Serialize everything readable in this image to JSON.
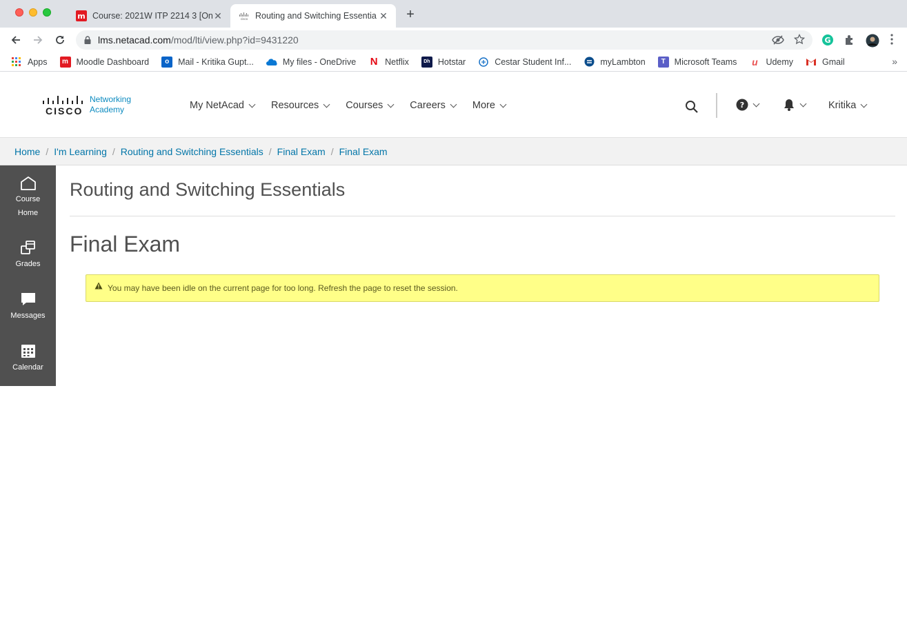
{
  "browser": {
    "tabs": [
      {
        "title": "Course: 2021W ITP 2214 3 [On",
        "favicon": "moodle-icon",
        "active": false
      },
      {
        "title": "Routing and Switching Essentia",
        "favicon": "cisco-icon",
        "active": true
      }
    ],
    "url_host": "lms.netacad.com",
    "url_path": "/mod/lti/view.php?id=9431220",
    "bookmarks": [
      {
        "label": "Apps",
        "icon": "apps-grid-icon"
      },
      {
        "label": "Moodle Dashboard",
        "icon": "moodle-icon",
        "color": "#e21a22"
      },
      {
        "label": "Mail - Kritika Gupt...",
        "icon": "outlook-icon",
        "color": "#0a64c8"
      },
      {
        "label": "My files - OneDrive",
        "icon": "onedrive-icon",
        "color": "#0a78d4"
      },
      {
        "label": "Netflix",
        "icon": "netflix-icon",
        "color": "#e50914"
      },
      {
        "label": "Hotstar",
        "icon": "hotstar-icon",
        "color": "#0f1a4a"
      },
      {
        "label": "Cestar Student Inf...",
        "icon": "cestar-icon",
        "color": "#1a73c8"
      },
      {
        "label": "myLambton",
        "icon": "lambton-icon",
        "color": "#0b4d8c"
      },
      {
        "label": "Microsoft Teams",
        "icon": "teams-icon",
        "color": "#5b5fc7"
      },
      {
        "label": "Udemy",
        "icon": "udemy-icon",
        "color": "#ea5252"
      },
      {
        "label": "Gmail",
        "icon": "gmail-icon",
        "color": "#d93025"
      }
    ],
    "bookmarks_overflow": "»"
  },
  "header": {
    "logo_brand": "CISCO",
    "logo_line1": "Networking",
    "logo_line2": "Academy",
    "nav": [
      "My NetAcad",
      "Resources",
      "Courses",
      "Careers",
      "More"
    ],
    "user_name": "Kritika"
  },
  "breadcrumb": [
    "Home",
    "I'm Learning",
    "Routing and Switching Essentials",
    "Final Exam",
    "Final Exam"
  ],
  "drawer": [
    {
      "label_line1": "Course",
      "label_line2": "Home",
      "icon": "home-icon"
    },
    {
      "label_line1": "Grades",
      "label_line2": "",
      "icon": "grades-icon"
    },
    {
      "label_line1": "Messages",
      "label_line2": "",
      "icon": "messages-icon"
    },
    {
      "label_line1": "Calendar",
      "label_line2": "",
      "icon": "calendar-icon"
    }
  ],
  "main": {
    "course_title": "Routing and Switching Essentials",
    "page_heading": "Final Exam",
    "alert_text": "You may have been idle on the current page for too long. Refresh the page to reset the session."
  },
  "colors": {
    "link": "#0275a8",
    "drawer_bg": "#505050",
    "alert_bg": "#ffff88",
    "cisco_blue": "#0d8bc0"
  }
}
